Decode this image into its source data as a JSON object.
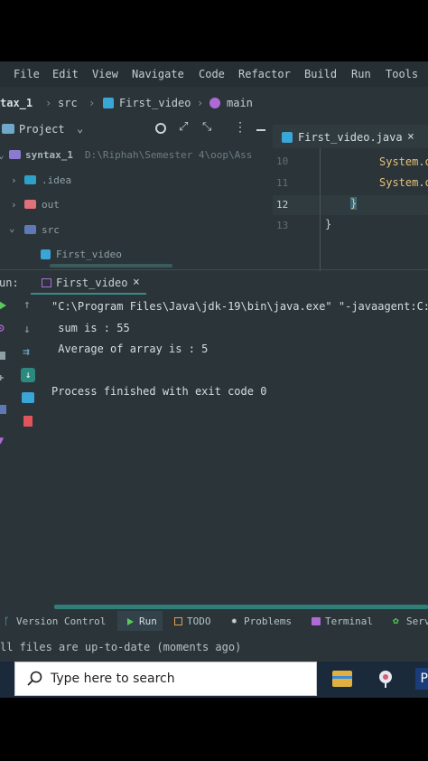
{
  "menu": {
    "items": [
      "File",
      "Edit",
      "View",
      "Navigate",
      "Code",
      "Refactor",
      "Build",
      "Run",
      "Tools"
    ]
  },
  "breadcrumb": {
    "project": "tax_1",
    "src": "src",
    "class": "First_video",
    "method": "main"
  },
  "project_panel": {
    "title": "Project",
    "root_name": "syntax_1",
    "root_path": "D:\\Riphah\\Semester 4\\oop\\Ass",
    "items": [
      ".idea",
      "out",
      "src",
      "First_video"
    ]
  },
  "editor": {
    "tab_label": "First_video.java",
    "line_numbers": [
      "10",
      "11",
      "12",
      "13"
    ],
    "lines": [
      "System.o",
      "System.o",
      "}",
      "}"
    ]
  },
  "run_panel": {
    "label": "un:",
    "tab_label": "First_video",
    "console": [
      "\"C:\\Program Files\\Java\\jdk-19\\bin\\java.exe\" \"-javaagent:C:",
      " sum is : 55",
      " Average of array is : 5",
      "",
      "Process finished with exit code 0"
    ]
  },
  "bottom_tabs": [
    "Version Control",
    "Run",
    "TODO",
    "Problems",
    "Terminal",
    "Serv"
  ],
  "status_text": "ll files are up-to-date (moments ago)",
  "taskbar": {
    "search_placeholder": "Type here to search"
  },
  "colors": {
    "accent": "#3b8a8a",
    "run_green": "#5ac85a",
    "stop_red": "#e0545c"
  }
}
